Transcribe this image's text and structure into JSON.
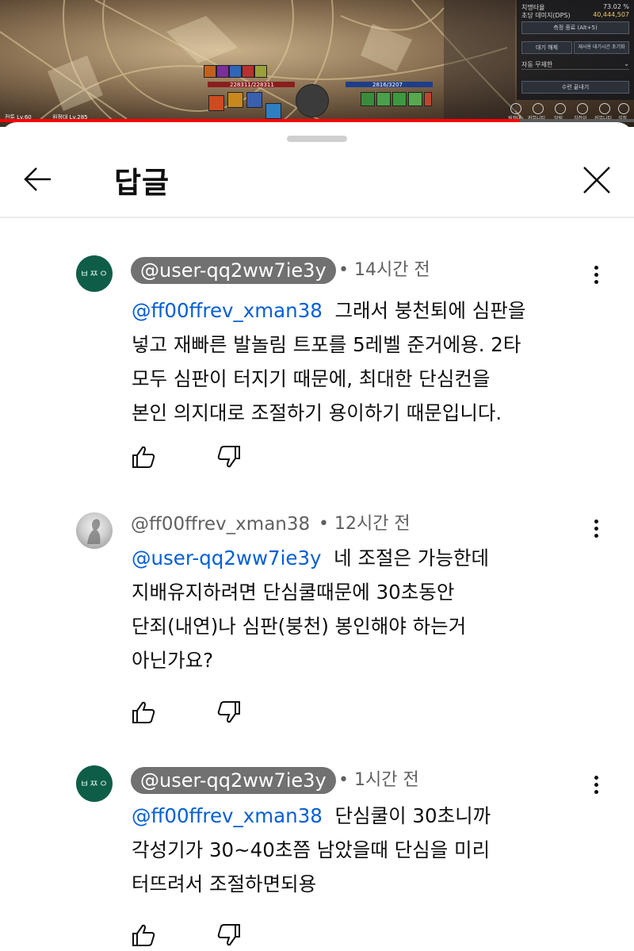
{
  "video": {
    "hud": {
      "row1_label": "치명타율",
      "row1_value": "73.02 %",
      "row2_label": "초당 데미지(DPS)",
      "row2_value": "40,444,507",
      "btn_measure": "측정 종료 (Alt+5)",
      "btn_wait": "대기 해제",
      "btn_reset": "재사용 대기시간 초기화",
      "row_invincible": "자동 무제한",
      "btn_training": "수련 끝내기"
    },
    "hp_text": "228311/228311",
    "mp_text": "2816/3207",
    "char_left": "전투 Lv.60",
    "char_right": "원정대 Lv.285",
    "hud_icons": [
      "원정대",
      "커뮤니티",
      "알림",
      "길잡이",
      "커뮤니티",
      "설정"
    ],
    "progress_fraction": 0.82
  },
  "header": {
    "title": "답글",
    "back_icon": "arrow-left-icon",
    "close_icon": "close-icon"
  },
  "comments": [
    {
      "avatar_text": "ㅂㅉㅇ",
      "author": "@user-qq2ww7ie3y",
      "author_style": "pill",
      "time": "• 14시간 전",
      "mention": "@ff00ffrev_xman38",
      "lines": [
        "그래서 붕천퇴에 심판을",
        "넣고 재빠른 발놀림 트포를 5레벨 준거에용. 2타",
        "모두 심판이 터지기 때문에, 최대한 단심컨을",
        "본인 의지대로 조절하기 용이하기 때문입니다."
      ]
    },
    {
      "avatar_text": "",
      "author": "@ff00ffrev_xman38",
      "author_style": "plain",
      "time": "• 12시간 전",
      "mention": "@user-qq2ww7ie3y",
      "lines": [
        "네 조절은 가능한데",
        "지배유지하려면 단심쿨때문에 30초동안",
        "단죄(내연)나 심판(붕천) 봉인해야  하는거",
        "아닌가요?"
      ]
    },
    {
      "avatar_text": "ㅂㅉㅇ",
      "author": "@user-qq2ww7ie3y",
      "author_style": "pill",
      "time": "• 1시간 전",
      "mention": "@ff00ffrev_xman38",
      "lines": [
        "단심쿨이 30초니까",
        "각성기가 30~40초쯤 남았을때 단심을 미리",
        "터뜨려서 조절하면되용"
      ]
    }
  ],
  "colors": {
    "mention": "#065fd4",
    "avatar_green": "#0e5d48",
    "pill_bg": "#717171",
    "progress_red": "#ff0000"
  }
}
